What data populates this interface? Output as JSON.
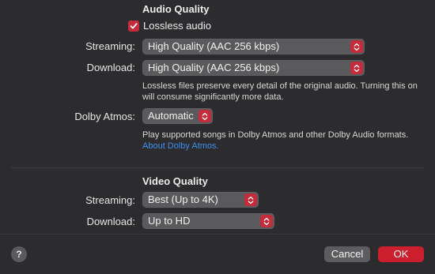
{
  "audio": {
    "title": "Audio Quality",
    "lossless_label": "Lossless audio",
    "lossless_checked": true,
    "streaming_label": "Streaming:",
    "streaming_value": "High Quality (AAC 256 kbps)",
    "download_label": "Download:",
    "download_value": "High Quality (AAC 256 kbps)",
    "lossless_desc_line1": "Lossless files preserve every detail of the original audio. Turning this on",
    "lossless_desc_line2": "will consume significantly more data.",
    "dolby_label": "Dolby Atmos:",
    "dolby_value": "Automatic",
    "dolby_desc": "Play supported songs in Dolby Atmos and other Dolby Audio formats.",
    "dolby_link": "About Dolby Atmos."
  },
  "video": {
    "title": "Video Quality",
    "streaming_label": "Streaming:",
    "streaming_value": "Best (Up to 4K)",
    "download_label": "Download:",
    "download_value": "Up to HD"
  },
  "footer": {
    "help": "?",
    "cancel": "Cancel",
    "ok": "OK"
  },
  "colors": {
    "accent": "#c62b3b",
    "link": "#3d8ff0",
    "background": "#2c2c2e"
  }
}
